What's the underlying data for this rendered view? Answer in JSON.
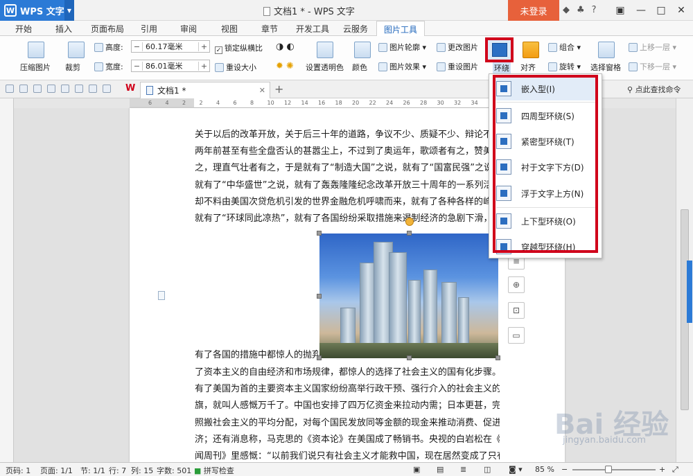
{
  "app": {
    "logo": "WPS 文字",
    "title": "文档1 * - WPS 文字",
    "login": "未登录"
  },
  "window": {
    "minimize": "—",
    "maximize": "□",
    "close": "✕",
    "restore": "▣"
  },
  "menu": {
    "tabs": [
      "开始",
      "插入",
      "页面布局",
      "引用",
      "审阅",
      "视图",
      "章节",
      "开发工具",
      "云服务",
      "图片工具"
    ],
    "active": "图片工具"
  },
  "ribbon": {
    "compress": "压缩图片",
    "crop": "裁剪",
    "height_label": "高度:",
    "height_value": "60.17毫米",
    "width_label": "宽度:",
    "width_value": "86.01毫米",
    "lock_ratio": "锁定纵横比",
    "reset_size": "重设大小",
    "transparent": "设置透明色",
    "color": "颜色",
    "outline": "图片轮廓",
    "effect": "图片效果",
    "change_pic": "更改图片",
    "reset_pic": "重设图片",
    "wrap": "环绕",
    "align": "对齐",
    "group": "组合",
    "rotate": "旋转",
    "selection_pane": "选择窗格",
    "bring_forward": "上移一层",
    "send_backward": "下移一层"
  },
  "quickbar": {
    "doc_tab": "文档1 *",
    "find_command": "点此查找命令"
  },
  "ruler": {
    "ticks": [
      "6",
      "4",
      "2",
      "2",
      "4",
      "6",
      "8",
      "10",
      "12",
      "14",
      "16",
      "18",
      "20",
      "22",
      "24",
      "26",
      "28",
      "30",
      "32",
      "34"
    ]
  },
  "document": {
    "lines_top": [
      "关于以后的改革开放，关于后三十年的道路，争议不少、质疑不少、辩论不少。",
      "两年前甚至有些全盘否认的甚嚣尘上，不过到了奥运年，歌颂者有之，赞美者有",
      "之，理直气壮者有之，于是就有了“制造大国”之说，就有了“国富民强”之说，",
      "就有了“中华盛世”之说，就有了轰轰隆隆纪念改革开放三十周年的一系列活动，",
      "却不料由美国次贷危机引发的世界金融危机呼啸而来，就有了各种各样的峰会，",
      "就有了“环球同此凉热”，就有了各国纷纷采取措施来遏制经济的急剧下滑，"
    ],
    "line_mid": "有了各国的措施中都惊人的抛弃",
    "lines_bottom": [
      "了资本主义的自由经济和市场规律，都惊人的选择了社会主义的国有化步骤。就",
      "有了美国为首的主要资本主义国家纷纷高举行政干预、强行介入的社会主义的大",
      "旗，就叫人感慨万千了。中国也安排了四万亿资金来拉动内需；日本更甚，完全",
      "照搬社会主义的平均分配，对每个国民发放同等金额的现金来推动消费、促进经",
      "济；还有消息称，马克思的《资本论》在美国成了畅销书。央视的白岩松在《新",
      "闻周刊》里感慨：“以前我们说只有社会主义才能救中国，现在居然变成了只有"
    ]
  },
  "wrap_menu": {
    "items": [
      "嵌入型(I)",
      "四周型环绕(S)",
      "紧密型环绕(T)",
      "衬于文字下方(D)",
      "浮于文字上方(N)",
      "上下型环绕(O)",
      "穿越型环绕(H)"
    ]
  },
  "side_tools": {
    "layout": "≡",
    "zoom": "⊕",
    "crop": "⊡",
    "more": "▭"
  },
  "status": {
    "page_no": "页码: 1",
    "pages": "页面: 1/1",
    "section": "节: 1/1",
    "row": "行: 7",
    "col": "列: 15",
    "words": "字数: 501",
    "spell": "拼写检查",
    "zoom": "85 %"
  },
  "watermark": {
    "main": "Bai 经验",
    "sub": "jingyan.baidu.com"
  },
  "colors": {
    "accent": "#2b7ad6",
    "login": "#e7613b",
    "highlight": "#d0021b"
  }
}
